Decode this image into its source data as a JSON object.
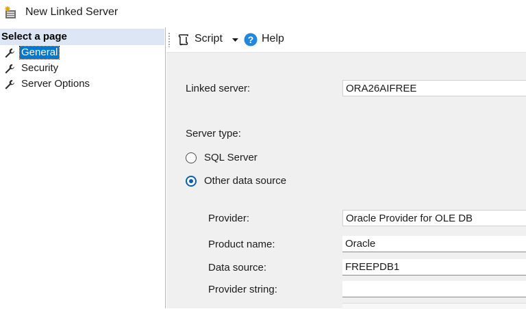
{
  "window": {
    "title": "New Linked Server"
  },
  "sidebar": {
    "header": "Select a page",
    "items": [
      {
        "label": "General",
        "selected": true,
        "icon": "wrench-icon"
      },
      {
        "label": "Security",
        "selected": false,
        "icon": "wrench-icon"
      },
      {
        "label": "Server Options",
        "selected": false,
        "icon": "wrench-icon"
      }
    ]
  },
  "toolbar": {
    "script_label": "Script",
    "help_label": "Help"
  },
  "form": {
    "linked_server_label": "Linked server:",
    "linked_server_value": "ORA26AIFREE",
    "server_type_label": "Server type:",
    "server_type_options": [
      {
        "label": "SQL Server",
        "selected": false
      },
      {
        "label": "Other data source",
        "selected": true
      }
    ],
    "provider_label": "Provider:",
    "provider_value": "Oracle Provider for OLE DB",
    "product_name_label": "Product name:",
    "product_name_value": "Oracle",
    "data_source_label": "Data source:",
    "data_source_value": "FREEPDB1",
    "provider_string_label": "Provider string:",
    "provider_string_value": ""
  },
  "colors": {
    "accent": "#0078d7",
    "sidebar_header_bg": "#dce6f4",
    "content_bg": "#f0f0f0",
    "radio_selected": "#0060c0"
  }
}
